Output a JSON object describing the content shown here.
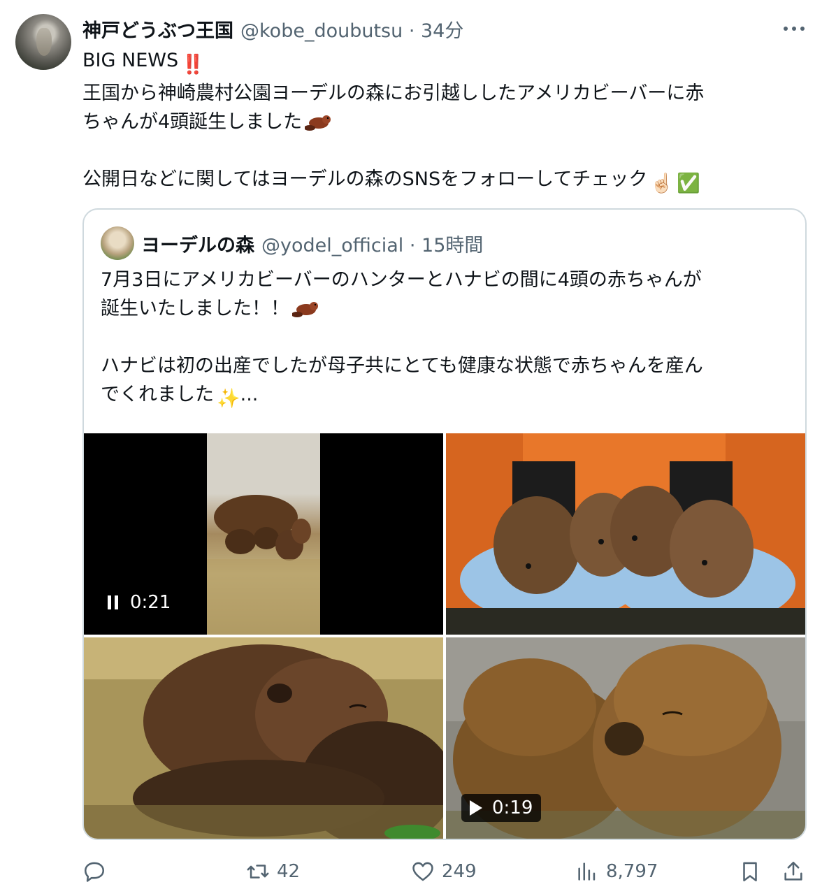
{
  "tweet": {
    "author": {
      "display_name": "神戸どうぶつ王国",
      "handle": "@kobe_doubutsu",
      "time": "34分"
    },
    "text": {
      "line1": "BIG NEWS",
      "line2": "王国から神崎農村公園ヨーデルの森にお引越ししたアメリカビーバーに赤",
      "line3": "ちゃんが4頭誕生しました",
      "line4": "公開日などに関してはヨーデルの森のSNSをフォローしてチェック"
    },
    "emoji": {
      "bang": "‼️",
      "beaver": "beaver-emoji",
      "finger": "☝🏻",
      "check": "✅"
    }
  },
  "quoted": {
    "author": {
      "display_name": "ヨーデルの森",
      "handle": "@yodel_official",
      "time": "15時間"
    },
    "text": {
      "line1": "7月3日にアメリカビーバーのハンターとハナビの間に4頭の赤ちゃんが",
      "line2": "誕生いたしました！！",
      "line3": "ハナビは初の出産でしたが母子共にとても健康な状態で赤ちゃんを産ん",
      "line4": "でくれました",
      "ellipsis": "..."
    },
    "emoji": {
      "sparkles": "✨"
    },
    "media": [
      {
        "kind": "video",
        "duration": "0:21",
        "state": "playing"
      },
      {
        "kind": "photo",
        "subject": "four baby beavers held in gloved hands"
      },
      {
        "kind": "photo",
        "subject": "baby beaver sleeping on straw"
      },
      {
        "kind": "video",
        "duration": "0:19",
        "state": "paused"
      }
    ]
  },
  "actions": {
    "reply": "",
    "retweets": "42",
    "likes": "249",
    "views": "8,797"
  },
  "colors": {
    "text": "#0f1419",
    "secondary": "#536471",
    "border": "#cfd9de",
    "beaver": "#8b3a1e"
  }
}
